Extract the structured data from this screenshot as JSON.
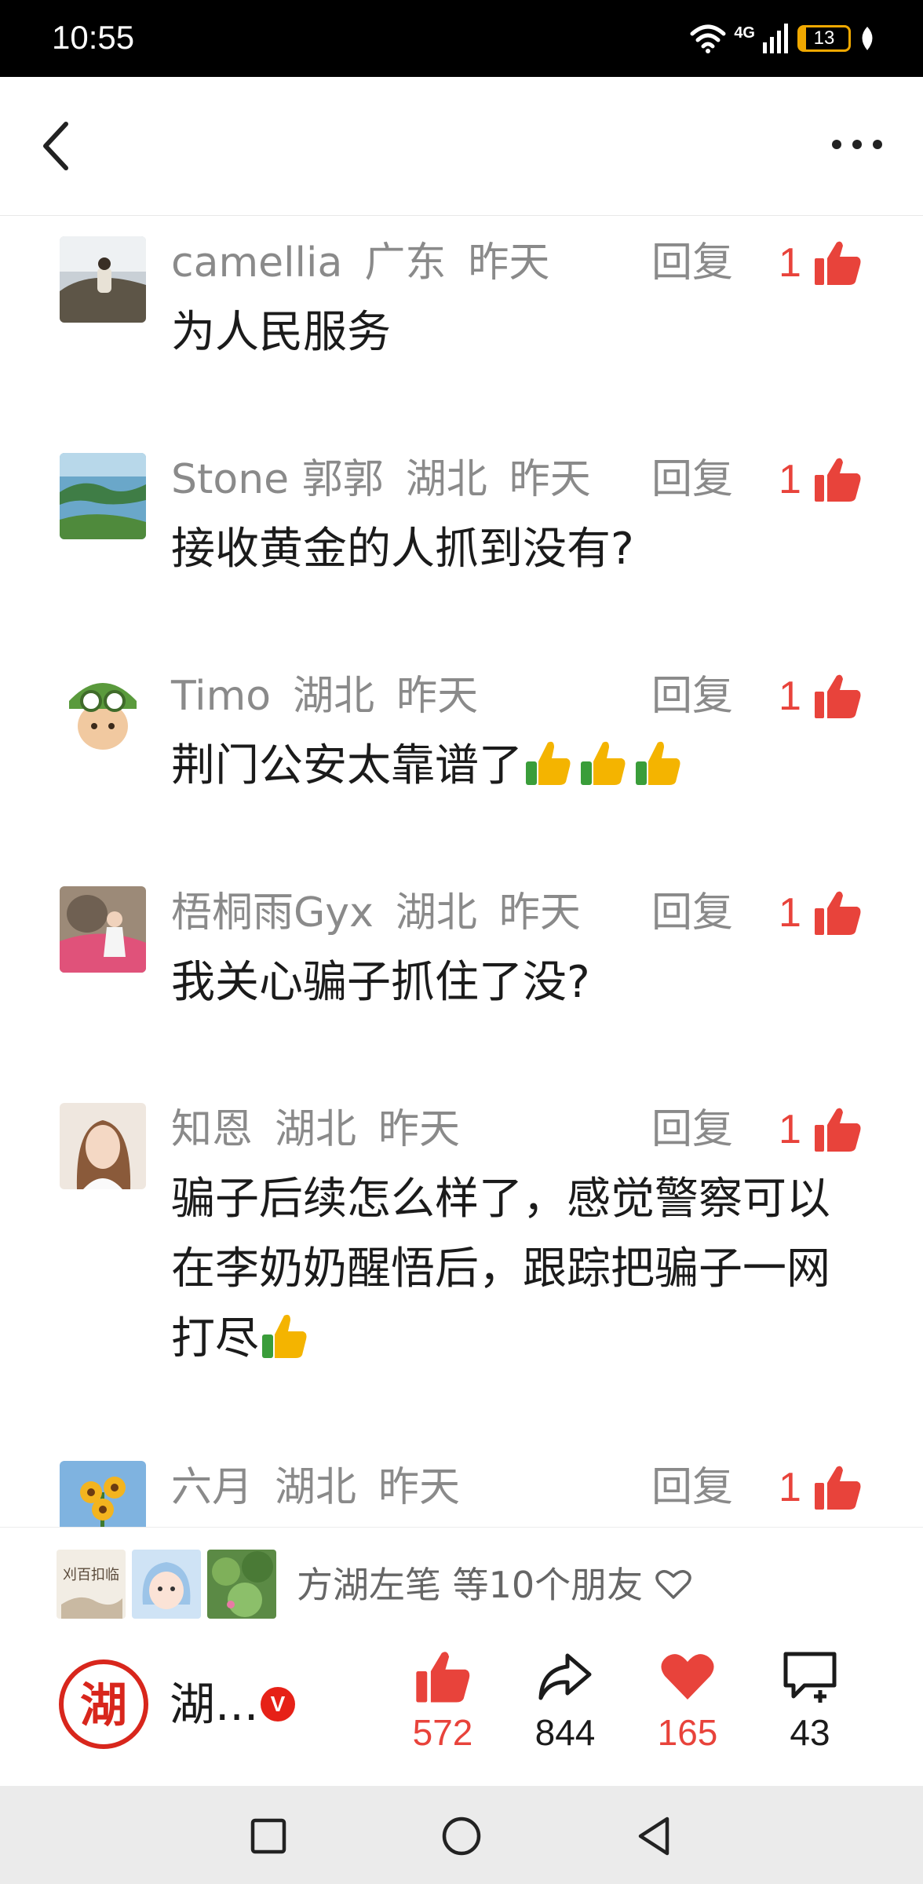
{
  "status_bar": {
    "time": "10:55",
    "network": "4G",
    "battery": "13",
    "battery_level": 0.13
  },
  "comments": [
    {
      "user": "camellia",
      "region": "广东",
      "time": "昨天",
      "reply": "回复",
      "likes": "1",
      "text": "为人民服务"
    },
    {
      "user": "Stone 郭郭",
      "region": "湖北",
      "time": "昨天",
      "reply": "回复",
      "likes": "1",
      "text": "接收黄金的人抓到没有?"
    },
    {
      "user": "Timo",
      "region": "湖北",
      "time": "昨天",
      "reply": "回复",
      "likes": "1",
      "text": "荆门公安太靠谱了"
    },
    {
      "user": "梧桐雨Gyx",
      "region": "湖北",
      "time": "昨天",
      "reply": "回复",
      "likes": "1",
      "text": "我关心骗子抓住了没?"
    },
    {
      "user": "知恩",
      "region": "湖北",
      "time": "昨天",
      "reply": "回复",
      "likes": "1",
      "text": "骗子后续怎么样了，感觉警察可以在李奶奶醒悟后，跟踪把骗子一网打尽"
    },
    {
      "user": "六月",
      "region": "湖北",
      "time": "昨天",
      "reply": "回复",
      "likes": "1",
      "text": ""
    }
  ],
  "friends_bar": {
    "avatar_caption": "刈百扣临",
    "text": "方湖左笔 等10个朋友"
  },
  "author": {
    "logo_char": "湖",
    "name": "湖...",
    "verified": "V"
  },
  "actions": {
    "like": "572",
    "share": "844",
    "favorite": "165",
    "comment": "43"
  },
  "colors": {
    "accent": "#e8433b",
    "text": "#1b1b1b",
    "meta": "#8a8a8a",
    "nav_bg": "#ebebeb"
  }
}
